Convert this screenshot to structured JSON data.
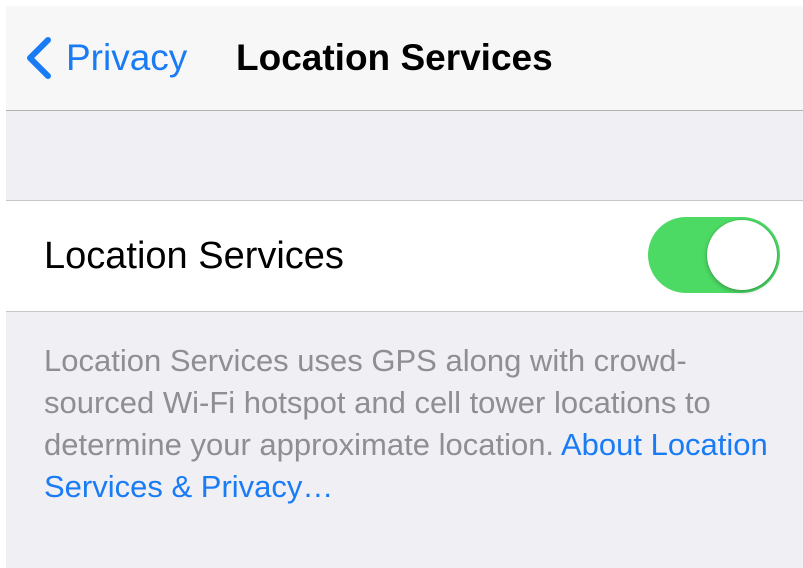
{
  "navbar": {
    "back_label": "Privacy",
    "back_icon": "chevron-left-icon",
    "title": "Location Services"
  },
  "setting": {
    "label": "Location Services",
    "enabled": true
  },
  "footer": {
    "text": "Location Services uses GPS along with crowd-sourced Wi-Fi hotspot and cell tower locations to determine your approximate location.",
    "link_text": "About Location Services & Privacy…"
  },
  "colors": {
    "accent": "#1a7cf5",
    "toggle_on": "#4cd964",
    "footer_text": "#8e8e93",
    "background": "#efeff4"
  }
}
